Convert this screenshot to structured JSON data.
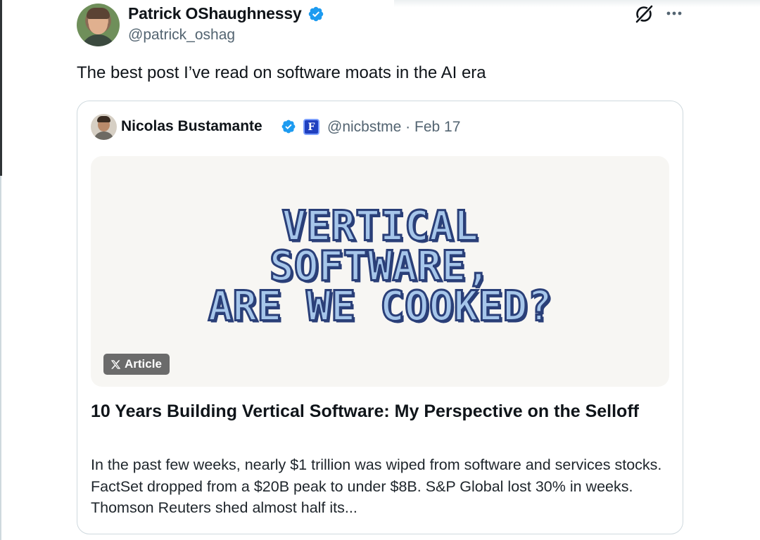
{
  "post": {
    "author": {
      "name": "Patrick OShaughnessy",
      "handle": "@patrick_oshag",
      "verified_color": "#1d9bf0"
    },
    "text": "The best post I’ve read on software moats in the AI era",
    "icons": [
      "grok-icon",
      "more-icon"
    ]
  },
  "quote": {
    "author": {
      "name": "Nicolas Bustamante",
      "handle": "@nicbstme",
      "date": "Feb 17",
      "affiliate_letter": "F"
    },
    "meta": "@nicbstme · Feb 17",
    "image": {
      "title_lines": [
        "VERTICAL",
        "SOFTWARE,",
        "ARE WE COOKED?"
      ]
    },
    "badge": {
      "label": "Article"
    },
    "headline": "10 Years Building Vertical Software: My Perspective on the Selloff",
    "excerpt": "In the past few weeks, nearly $1 trillion was wiped from software and services stocks. FactSet dropped from a $20B peak to under $8B. S&P Global lost 30% in weeks. Thomson Reuters shed almost half its..."
  },
  "colors": {
    "text_primary": "#0f1419",
    "text_secondary": "#536471",
    "border": "#cfd9de",
    "pixel_fill": "#a6c6ea",
    "pixel_outline": "#2a3f78"
  }
}
